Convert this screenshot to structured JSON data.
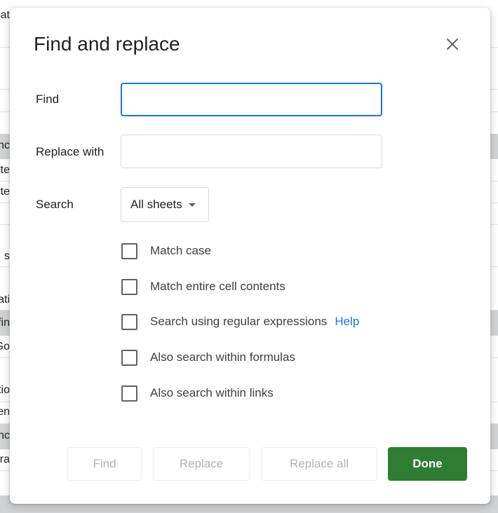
{
  "background": {
    "cells": [
      {
        "text": "at"
      },
      {
        "text": "nc"
      },
      {
        "text": "rte"
      },
      {
        "text": "rte"
      },
      {
        "text": "s"
      },
      {
        "text": "ati"
      },
      {
        "text": "fin"
      },
      {
        "text": "Go"
      },
      {
        "text": "tio"
      },
      {
        "text": "en"
      },
      {
        "text": "nc"
      },
      {
        "text": "Tra"
      }
    ]
  },
  "dialog": {
    "title": "Find and replace",
    "close_icon": "close-icon",
    "find": {
      "label": "Find",
      "value": "",
      "placeholder": ""
    },
    "replace": {
      "label": "Replace with",
      "value": "",
      "placeholder": ""
    },
    "search": {
      "label": "Search",
      "selected": "All sheets"
    },
    "options": [
      {
        "label": "Match case",
        "checked": false
      },
      {
        "label": "Match entire cell contents",
        "checked": false
      },
      {
        "label": "Search using regular expressions",
        "checked": false,
        "link": "Help"
      },
      {
        "label": "Also search within formulas",
        "checked": false
      },
      {
        "label": "Also search within links",
        "checked": false
      }
    ],
    "buttons": {
      "find": "Find",
      "replace": "Replace",
      "replace_all": "Replace all",
      "done": "Done"
    }
  },
  "colors": {
    "accent": "#1a73e8",
    "done_button": "#2e7d32",
    "disabled_text": "#b0b3b7"
  }
}
